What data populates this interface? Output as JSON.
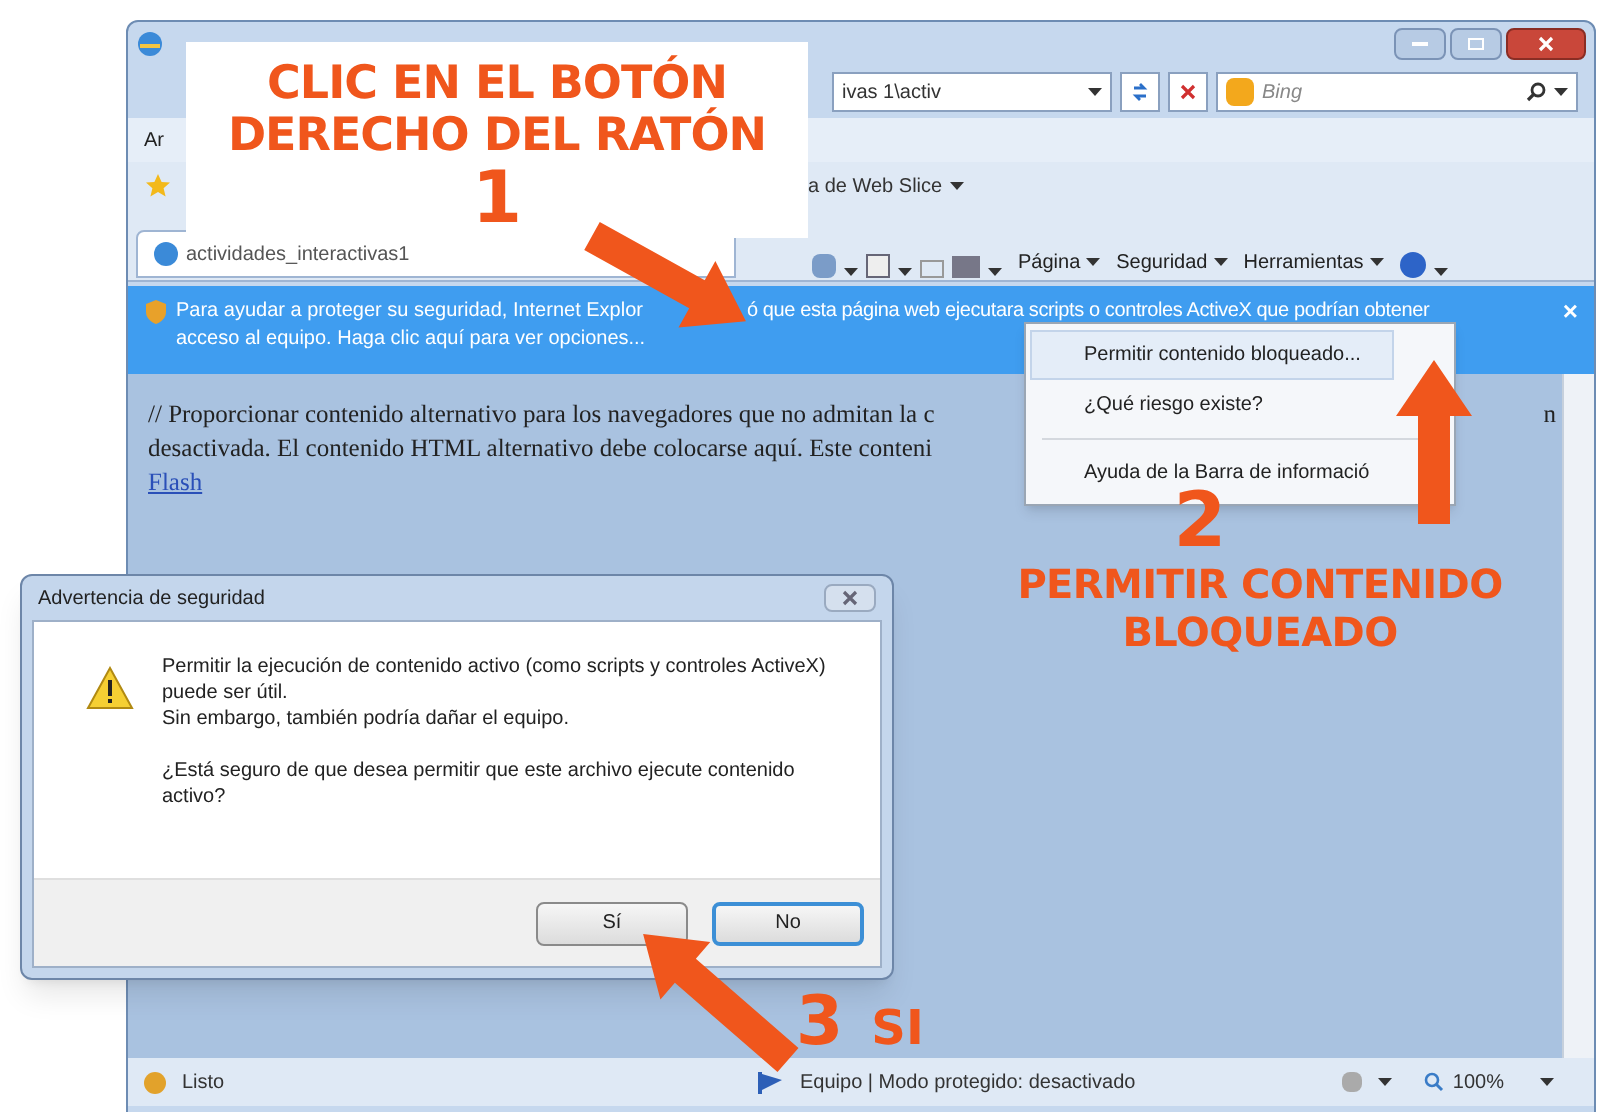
{
  "browser": {
    "menu_fragment": "Ar",
    "address_fragment": "ivas 1\\activ",
    "search_placeholder": "Bing",
    "favorites_fragment": "a de Web Slice",
    "tab_title": "actividades_interactivas1",
    "command_bar": [
      "Página",
      "Seguridad",
      "Herramientas"
    ],
    "infobar": {
      "line1_start": "Para ayudar a proteger su seguridad, Internet Explor",
      "line1_end": "ó que esta página web ejecutara scripts o controles ActiveX que podrían obtener",
      "line2": "acceso al equipo. Haga clic aquí para ver opciones...",
      "close": "×"
    },
    "content": {
      "line1": "// Proporcionar contenido alternativo para los navegadores que no admitan la c",
      "line1_tail": "n",
      "line2": "desactivada. El contenido HTML alternativo debe colocarse aquí. Este conteni",
      "link": "Flash"
    },
    "status": {
      "text": "Listo",
      "zone": "Equipo | Modo protegido: desactivado",
      "zoom": "100%"
    }
  },
  "context_menu": {
    "items": [
      {
        "label": "Permitir contenido bloqueado...",
        "selected": true,
        "separator_before": false
      },
      {
        "label": "¿Qué riesgo existe?",
        "selected": false,
        "separator_before": false
      },
      {
        "label": "Ayuda de la Barra de informació",
        "selected": false,
        "separator_before": true
      }
    ]
  },
  "dialog": {
    "title": "Advertencia de seguridad",
    "message": "Permitir la ejecución de contenido activo (como scripts y controles ActiveX) puede ser útil.",
    "message2": "Sin embargo, también podría dañar el equipo.",
    "question": "¿Está seguro de que desea permitir que este archivo ejecute contenido activo?",
    "buttons": [
      {
        "label": "Sí",
        "focused": false
      },
      {
        "label": "No",
        "focused": true
      }
    ]
  },
  "annotations": {
    "step1": {
      "number": "1",
      "lines": [
        "CLIC EN EL BOTÓN",
        "DERECHO DEL RATÓN"
      ]
    },
    "step2": {
      "number": "2",
      "lines": [
        "PERMITIR CONTENIDO",
        "BLOQUEADO"
      ]
    },
    "step3": {
      "number": "3",
      "text": "SI"
    }
  }
}
